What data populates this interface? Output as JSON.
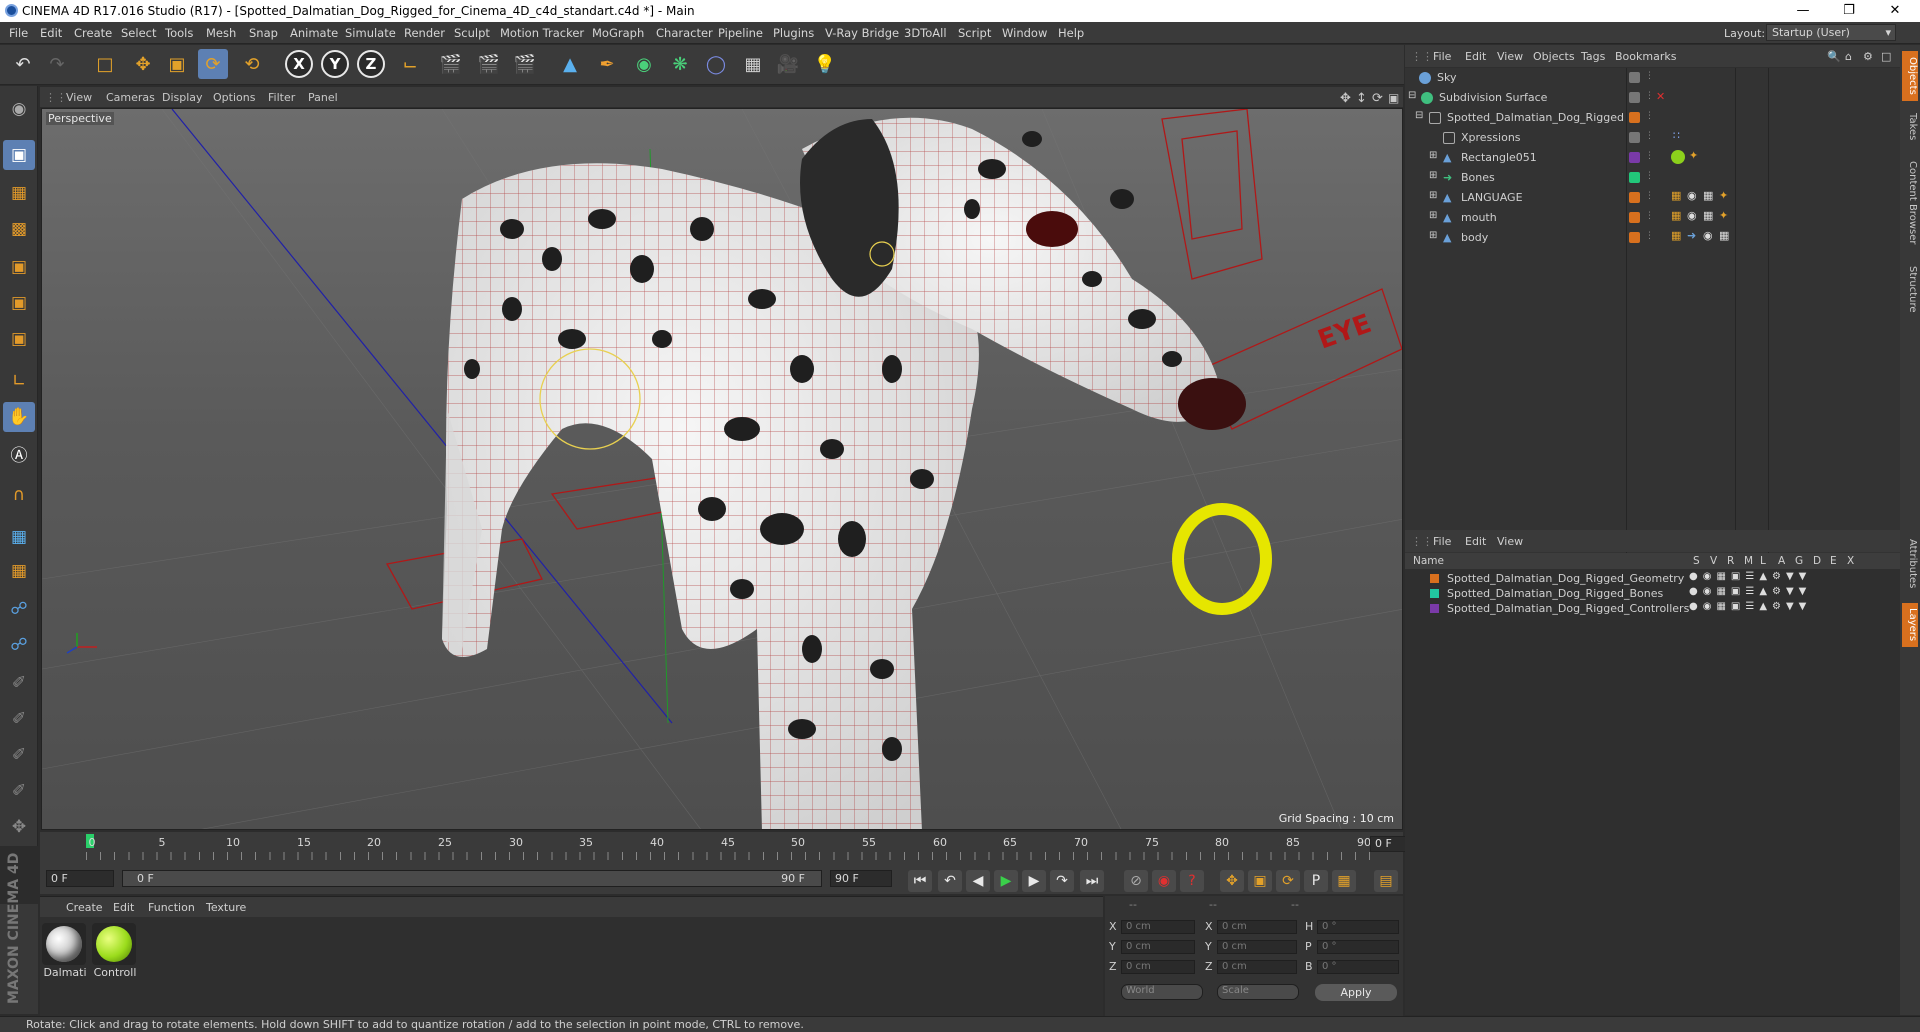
{
  "window": {
    "title": "CINEMA 4D R17.016 Studio (R17) - [Spotted_Dalmatian_Dog_Rigged_for_Cinema_4D_c4d_standart.c4d *] - Main",
    "min_icon": "minimize-icon",
    "max_icon": "maximize-icon",
    "close_icon": "close-icon"
  },
  "menubar": {
    "items": [
      "File",
      "Edit",
      "Create",
      "Select",
      "Tools",
      "Mesh",
      "Snap",
      "Animate",
      "Simulate",
      "Render",
      "Sculpt",
      "Motion Tracker",
      "MoGraph",
      "Character",
      "Pipeline",
      "Plugins",
      "V-Ray Bridge",
      "3DToAll",
      "Script",
      "Window",
      "Help"
    ],
    "layout_label": "Layout:",
    "layout_value": "Startup (User)"
  },
  "viewport": {
    "menu": [
      "View",
      "Cameras",
      "Display",
      "Options",
      "Filter",
      "Panel"
    ],
    "camera_label": "Perspective",
    "grid_spacing": "Grid Spacing : 10 cm",
    "annotation_text": "EYE"
  },
  "timeline": {
    "ticks": [
      "0",
      "5",
      "10",
      "15",
      "20",
      "25",
      "30",
      "35",
      "40",
      "45",
      "50",
      "55",
      "60",
      "65",
      "70",
      "75",
      "80",
      "85",
      "90"
    ],
    "end_frame_display": "0 F",
    "current_frame": "0 F",
    "range_start": "0 F",
    "range_end_in_slider": "90 F",
    "range_end": "90 F"
  },
  "materials": {
    "menu": [
      "Create",
      "Edit",
      "Function",
      "Texture"
    ],
    "items": [
      {
        "label": "Dalmati",
        "color": "#d8d8d8"
      },
      {
        "label": "Controll",
        "color": "#9bdc1c"
      }
    ]
  },
  "coordinates": {
    "header_dashes": [
      "--",
      "--",
      "--"
    ],
    "rows": [
      {
        "a": "X",
        "av": "0 cm",
        "b": "X",
        "bv": "0 cm",
        "c": "H",
        "cv": "0 °"
      },
      {
        "a": "Y",
        "av": "0 cm",
        "b": "Y",
        "bv": "0 cm",
        "c": "P",
        "cv": "0 °"
      },
      {
        "a": "Z",
        "av": "0 cm",
        "b": "Z",
        "bv": "0 cm",
        "c": "B",
        "cv": "0 °"
      }
    ],
    "world": "World",
    "scale": "Scale",
    "apply": "Apply"
  },
  "object_manager": {
    "menu": [
      "File",
      "Edit",
      "View",
      "Objects",
      "Tags",
      "Bookmarks"
    ],
    "objects": [
      {
        "name": "Sky",
        "indent": 0,
        "icon_color": "#6aa0d8",
        "tag_color": "#777777"
      },
      {
        "name": "Subdivision Surface",
        "indent": 0,
        "icon_color": "#3fbf7f",
        "tag_color": "#777777"
      },
      {
        "name": "Spotted_Dalmatian_Dog_Rigged",
        "indent": 1,
        "icon_color": "#9a9a9a",
        "tag_color": "#d8701e"
      },
      {
        "name": "Xpressions",
        "indent": 2,
        "icon_color": "#9a9a9a",
        "tag_color": "#777777"
      },
      {
        "name": "Rectangle051",
        "indent": 2,
        "icon_color": "#5a9ad8",
        "tag_color": "#7a3aa8"
      },
      {
        "name": "Bones",
        "indent": 2,
        "icon_color": "#3fbf7f",
        "tag_color": "#22c77a"
      },
      {
        "name": "LANGUAGE",
        "indent": 2,
        "icon_color": "#5a9ad8",
        "tag_color": "#d8701e"
      },
      {
        "name": "mouth",
        "indent": 2,
        "icon_color": "#5a9ad8",
        "tag_color": "#d8701e"
      },
      {
        "name": "body",
        "indent": 2,
        "icon_color": "#5a9ad8",
        "tag_color": "#d8701e"
      }
    ]
  },
  "layer_manager": {
    "menu": [
      "File",
      "Edit",
      "View"
    ],
    "columns": [
      "Name",
      "S",
      "V",
      "R",
      "M",
      "L",
      "A",
      "G",
      "D",
      "E",
      "X"
    ],
    "layers": [
      {
        "name": "Spotted_Dalmatian_Dog_Rigged_Geometry",
        "color": "#d8701e"
      },
      {
        "name": "Spotted_Dalmatian_Dog_Rigged_Bones",
        "color": "#22c7a0"
      },
      {
        "name": "Spotted_Dalmatian_Dog_Rigged_Controllers",
        "color": "#7a3aa8"
      }
    ]
  },
  "side_tabs": [
    "Objects",
    "Takes",
    "Content Browser",
    "Structure",
    "Attributes",
    "Layers"
  ],
  "brand": "MAXON CINEMA 4D",
  "status": "Rotate: Click and drag to rotate elements. Hold down SHIFT to add to quantize rotation / add to the selection in point mode, CTRL to remove."
}
